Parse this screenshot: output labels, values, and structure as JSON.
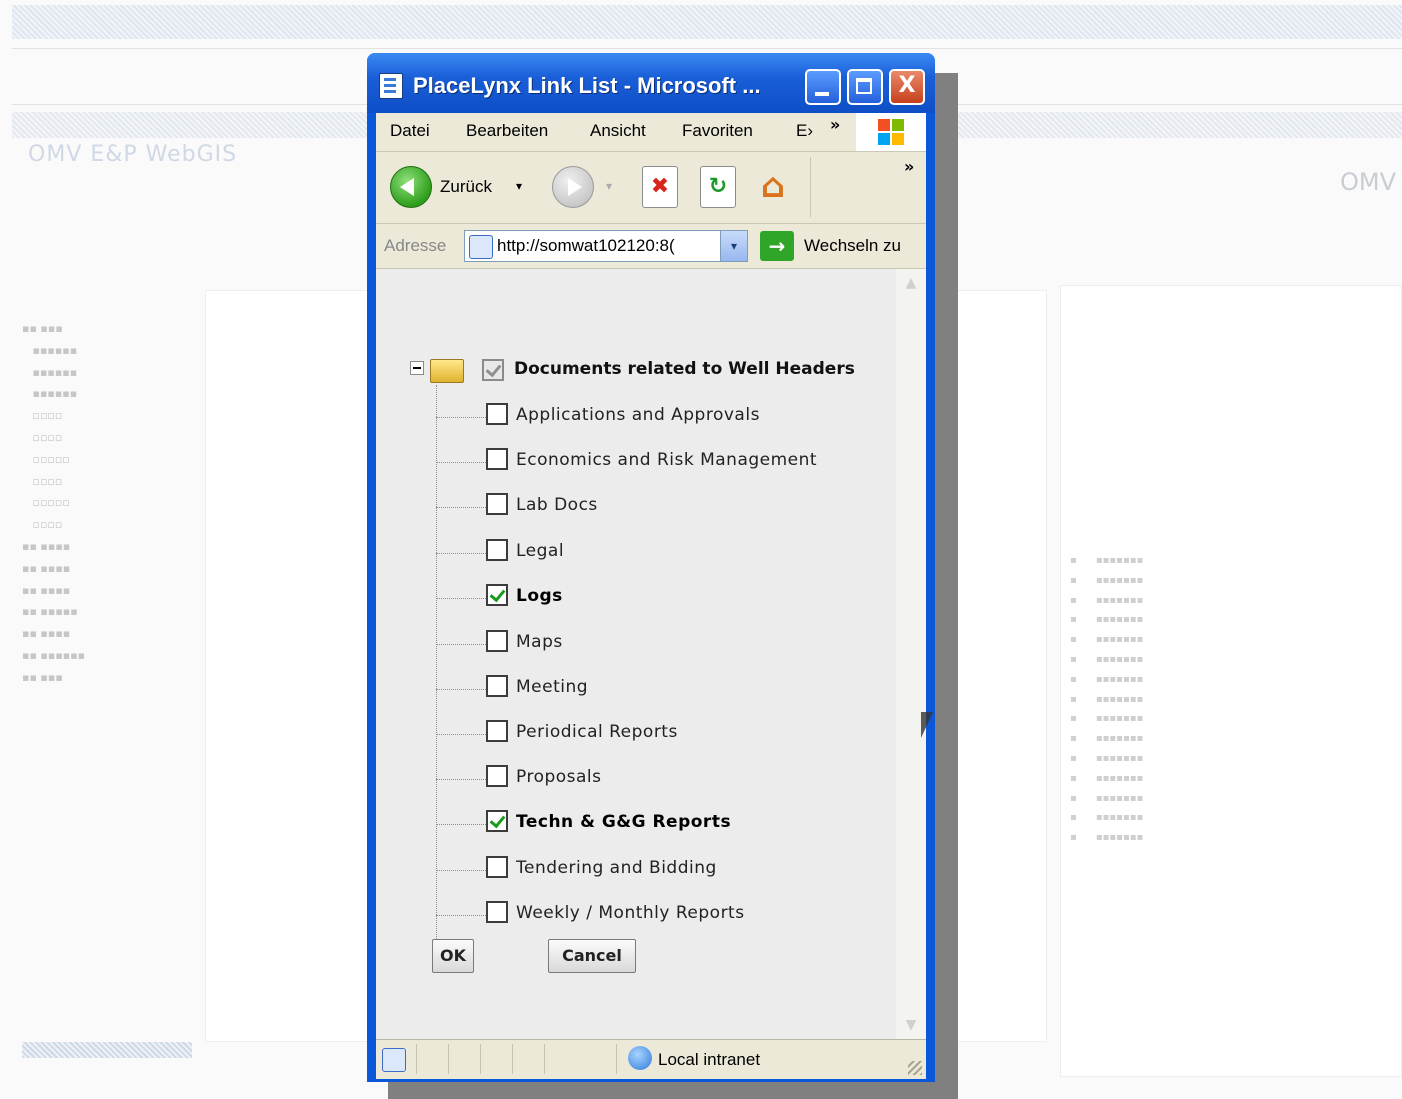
{
  "window": {
    "title": "PlaceLynx Link List - Microsoft ...",
    "minimize_label": "",
    "maximize_label": "",
    "close_label": "X"
  },
  "menu": {
    "items": [
      "Datei",
      "Bearbeiten",
      "Ansicht",
      "Favoriten",
      "E›"
    ],
    "overflow": "»"
  },
  "toolbar": {
    "back_label": "Zurück",
    "back_drop": "▾",
    "forward_drop": "▾",
    "overflow": "»",
    "stop_glyph": "✖",
    "refresh_glyph": "↻",
    "home_glyph": "⌂"
  },
  "address": {
    "label": "Adresse",
    "value": "http://somwat102120:8(",
    "drop": "▾",
    "go_glyph": "→",
    "go_label": "Wechseln zu"
  },
  "tree": {
    "root_label": "Documents related to Well Headers",
    "root_checked": true,
    "items": [
      {
        "label": "Applications and Approvals",
        "checked": false
      },
      {
        "label": "Economics and Risk Management",
        "checked": false
      },
      {
        "label": "Lab Docs",
        "checked": false
      },
      {
        "label": "Legal",
        "checked": false
      },
      {
        "label": "Logs",
        "checked": true
      },
      {
        "label": "Maps",
        "checked": false
      },
      {
        "label": "Meeting",
        "checked": false
      },
      {
        "label": "Periodical Reports",
        "checked": false
      },
      {
        "label": "Proposals",
        "checked": false
      },
      {
        "label": "Techn & G&G Reports",
        "checked": true
      },
      {
        "label": "Tendering and Bidding",
        "checked": false
      },
      {
        "label": "Weekly / Monthly Reports",
        "checked": false
      }
    ]
  },
  "buttons": {
    "ok": "OK",
    "cancel": "Cancel"
  },
  "status": {
    "zone": "Local intranet"
  },
  "background": {
    "app_title": "OMV E&P WebGIS",
    "brand": "OMV"
  }
}
